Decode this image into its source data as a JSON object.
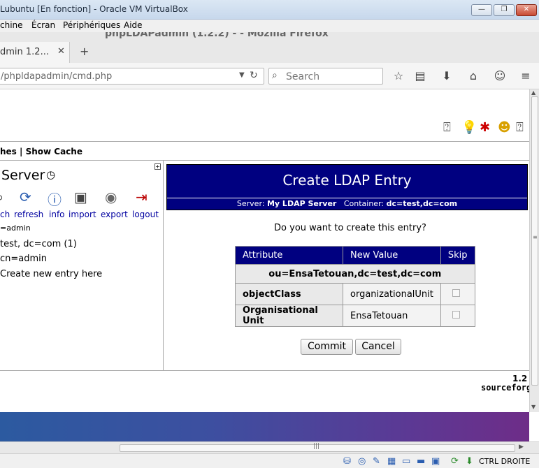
{
  "vbox": {
    "title": "Lubuntu [En fonction] - Oracle VM VirtualBox",
    "menu": [
      "chine",
      "Écran",
      "Périphériques",
      "Aide"
    ],
    "window_buttons": {
      "minimize": "—",
      "restore": "❐",
      "close": "✕"
    },
    "host_key": "CTRL DROITE"
  },
  "firefox": {
    "window_title": "phpLDAPadmin (1.2.2) - - Mozilla Firefox",
    "tab_label": "dmin 1.2...",
    "tab_close": "✕",
    "new_tab": "+",
    "url": "/phpldapadmin/cmd.php",
    "search_placeholder": "Search"
  },
  "page": {
    "links": "hes | Show Cache",
    "server_title": "Server",
    "toolbar": [
      "ch",
      "refresh",
      "info",
      "import",
      "export",
      "logout"
    ],
    "logged_in": "=admin",
    "tree": [
      "test, dc=com (1)",
      "cn=admin",
      "Create new entry here"
    ],
    "main_title": "Create LDAP Entry",
    "server_label": "Server:",
    "server_value": "My LDAP Server",
    "container_label": "Container:",
    "container_value": "dc=test,dc=com",
    "prompt": "Do you want to create this entry?",
    "table": {
      "headers": [
        "Attribute",
        "New Value",
        "Skip"
      ],
      "dn": "ou=EnsaTetouan,dc=test,dc=com",
      "rows": [
        {
          "attribute": "objectClass",
          "value": "organizationalUnit"
        },
        {
          "attribute": "Organisational Unit",
          "value": "EnsaTetouan"
        }
      ]
    },
    "commit_label": "Commit",
    "cancel_label": "Cancel",
    "version": "1.2",
    "sourceforge": "sourceforg"
  },
  "colors": {
    "header_blue": "#000080",
    "desktop_gradient_start": "#2c5aa0",
    "desktop_gradient_end": "#6e2d88"
  }
}
